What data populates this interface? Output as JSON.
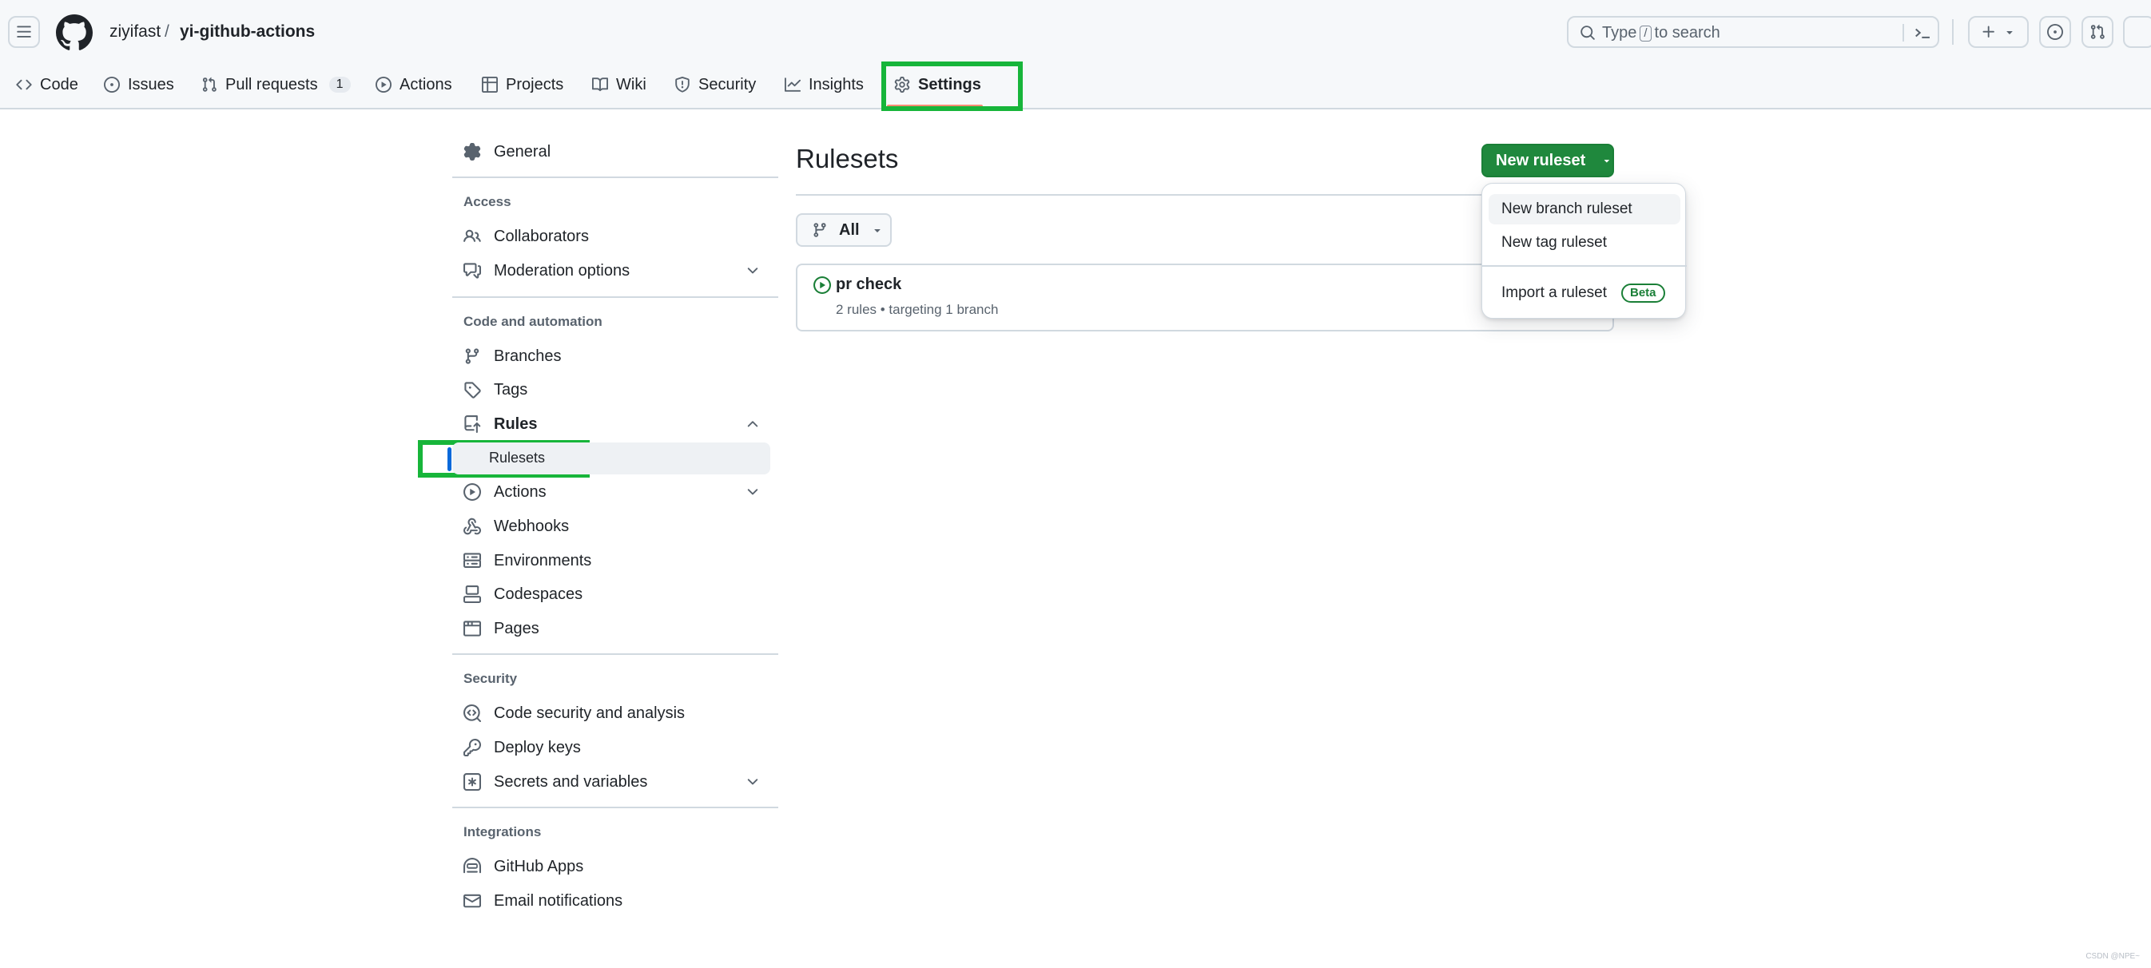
{
  "header": {
    "owner": "ziyifast",
    "separator": "/",
    "repo": "yi-github-actions",
    "search": {
      "prefix": "Type",
      "key": "/",
      "suffix": "to search"
    }
  },
  "nav": {
    "tabs": [
      {
        "label": "Code",
        "icon": "code-icon"
      },
      {
        "label": "Issues",
        "icon": "issue-opened-icon"
      },
      {
        "label": "Pull requests",
        "icon": "git-pull-request-icon",
        "count": "1"
      },
      {
        "label": "Actions",
        "icon": "play-icon"
      },
      {
        "label": "Projects",
        "icon": "table-icon"
      },
      {
        "label": "Wiki",
        "icon": "book-icon"
      },
      {
        "label": "Security",
        "icon": "shield-icon"
      },
      {
        "label": "Insights",
        "icon": "graph-icon"
      },
      {
        "label": "Settings",
        "icon": "gear-icon",
        "active": true
      }
    ]
  },
  "sidebar": {
    "general": "General",
    "sections": {
      "access": "Access",
      "code_automation": "Code and automation",
      "security": "Security",
      "integrations": "Integrations"
    },
    "items": {
      "collaborators": "Collaborators",
      "moderation": "Moderation options",
      "branches": "Branches",
      "tags": "Tags",
      "rules": "Rules",
      "rulesets": "Rulesets",
      "actions": "Actions",
      "webhooks": "Webhooks",
      "environments": "Environments",
      "codespaces": "Codespaces",
      "pages": "Pages",
      "code_security": "Code security and analysis",
      "deploy_keys": "Deploy keys",
      "secrets": "Secrets and variables",
      "github_apps": "GitHub Apps",
      "email_notifications": "Email notifications"
    }
  },
  "main": {
    "title": "Rulesets",
    "new_button": "New ruleset",
    "filter": "All",
    "ruleset": {
      "name": "pr check",
      "meta": "2 rules • targeting 1 branch"
    },
    "menu": {
      "branch": "New branch ruleset",
      "tag": "New tag ruleset",
      "import": "Import a ruleset",
      "badge": "Beta"
    }
  },
  "watermark": "CSDN @NPE~",
  "colors": {
    "primary_button": "#1f883d",
    "highlight_box": "#17b53a",
    "active_tab_underline": "#fd8c73",
    "selected_indicator": "#0969da"
  }
}
